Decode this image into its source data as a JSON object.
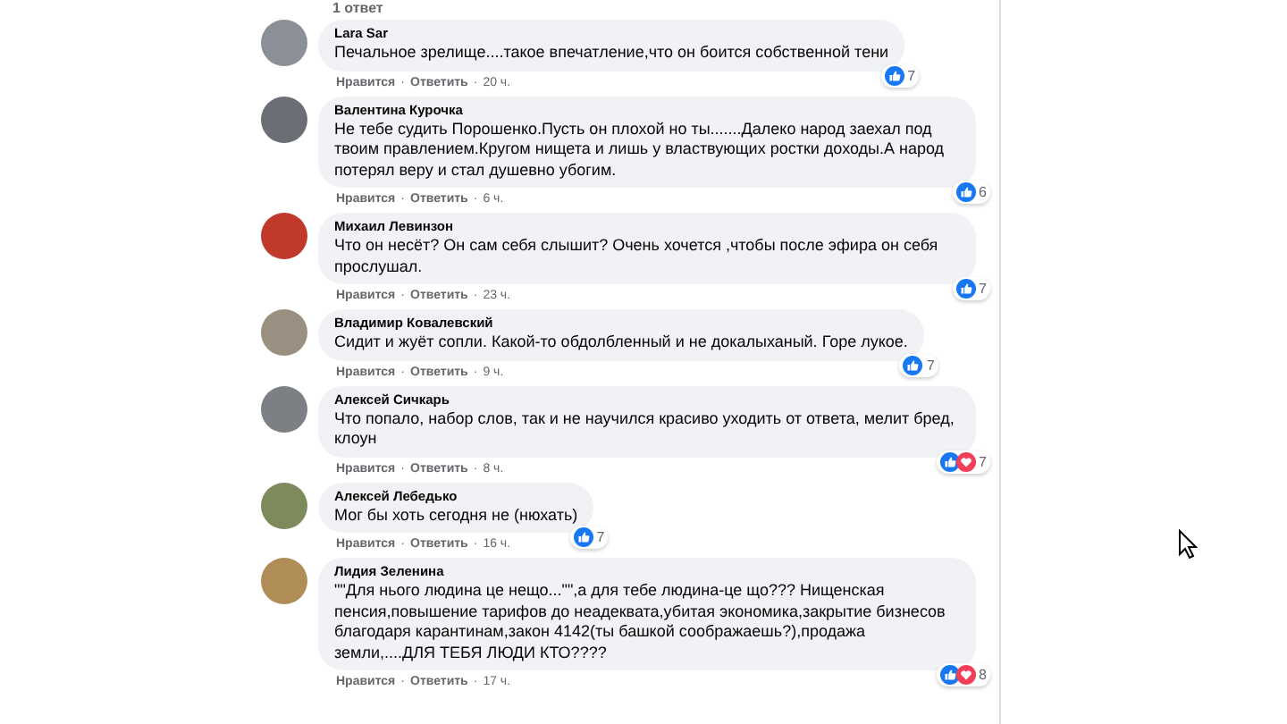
{
  "replies_link": "1 ответ",
  "separator": "·",
  "comments": [
    {
      "author": "Lara Sar",
      "text": "Печальное зрелище....такое впечатление,что он боится собственной тени",
      "like": "Нравится",
      "reply": "Ответить",
      "time": "20 ч.",
      "reactions": [
        {
          "kind": "like"
        }
      ],
      "count": "7"
    },
    {
      "author": "Валентина Курочка",
      "text": "Не тебе судить Порошенко.Пусть он плохой но ты.......Далеко народ заехал под твоим правлением.Кругом нищета и лишь у властвующих ростки доходы.А народ потерял веру и стал душевно убогим.",
      "like": "Нравится",
      "reply": "Ответить",
      "time": "6 ч.",
      "reactions": [
        {
          "kind": "like"
        }
      ],
      "count": "6"
    },
    {
      "author": "Михаил Левинзон",
      "text": "Что он несёт? Он сам себя слышит? Очень хочется ,чтобы после эфира он себя прослушал.",
      "like": "Нравится",
      "reply": "Ответить",
      "time": "23 ч.",
      "reactions": [
        {
          "kind": "like"
        }
      ],
      "count": "7"
    },
    {
      "author": "Владимир Ковалевский",
      "text": "Сидит и жуёт сопли. Какой-то обдолбленный и не докалыханый. Горе лукое.",
      "like": "Нравится",
      "reply": "Ответить",
      "time": "9 ч.",
      "reactions": [
        {
          "kind": "like"
        }
      ],
      "count": "7"
    },
    {
      "author": "Алексей Сичкарь",
      "text": "Что попало, набор слов, так и не научился красиво уходить от ответа, мелит бред, клоун",
      "like": "Нравится",
      "reply": "Ответить",
      "time": "8 ч.",
      "reactions": [
        {
          "kind": "like"
        },
        {
          "kind": "love"
        }
      ],
      "count": "7"
    },
    {
      "author": "Алексей Лебедько",
      "text": "Мог бы хоть сегодня не (нюхать)",
      "like": "Нравится",
      "reply": "Ответить",
      "time": "16 ч.",
      "reactions": [
        {
          "kind": "like"
        }
      ],
      "count": "7"
    },
    {
      "author": "Лидия Зеленина",
      "text": "\"\"Для нього людина це нещо...\"\",а для тебе людина-це що??? Нищенская пенсия,повышение тарифов до неадеквата,убитая экономика,закрытие бизнесов благодаря карантинам,закон 4142(ты башкой соображаешь?),продажа земли,....ДЛЯ ТЕБЯ ЛЮДИ КТО????",
      "like": "Нравится",
      "reply": "Ответить",
      "time": "17 ч.",
      "reactions": [
        {
          "kind": "like"
        },
        {
          "kind": "love"
        }
      ],
      "count": "8"
    }
  ]
}
